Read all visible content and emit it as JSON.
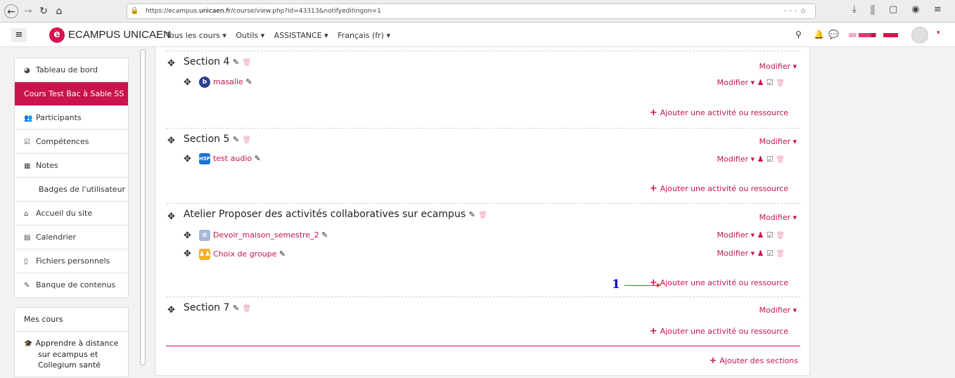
{
  "browser": {
    "url_prefix": "https://ecampus.",
    "url_host": "unicaen.fr",
    "url_suffix": "/course/view.php?id=43313&notifyeditingon=1"
  },
  "navbar": {
    "brand": "ECAMPUS UNICAEN",
    "logo_letter": "e",
    "menu": [
      "Tous les cours ▾",
      "Outils ▾",
      "ASSISTANCE ▾",
      "Français (fr) ▾"
    ]
  },
  "sidebar": {
    "items": [
      {
        "label": "Tableau de bord",
        "icon": "dashboard-icon",
        "glyph": "◕"
      },
      {
        "label": "Cours Test Bac à Sable SS",
        "icon": "",
        "glyph": ""
      },
      {
        "label": "Participants",
        "icon": "users-icon",
        "glyph": "👥"
      },
      {
        "label": "Compétences",
        "icon": "checkbox-icon",
        "glyph": "☑"
      },
      {
        "label": "Notes",
        "icon": "table-icon",
        "glyph": "▦"
      },
      {
        "label": "Badges de l'utilisateur",
        "icon": "",
        "glyph": ""
      },
      {
        "label": "Accueil du site",
        "icon": "home-icon",
        "glyph": "⌂"
      },
      {
        "label": "Calendrier",
        "icon": "calendar-icon",
        "glyph": "▤"
      },
      {
        "label": "Fichiers personnels",
        "icon": "file-icon",
        "glyph": "▯"
      },
      {
        "label": "Banque de contenus",
        "icon": "brush-icon",
        "glyph": "✎"
      }
    ],
    "mes_cours": "Mes cours",
    "course_line1": "Apprendre à distance",
    "course_line2": "sur ecampus et",
    "course_line3": "Collegium santé"
  },
  "main": {
    "modifier": "Modifier ▾",
    "ajouter": "Ajouter une activité ou ressource",
    "ajouter_sections": "Ajouter des sections",
    "sections": [
      {
        "title": "Section 4",
        "activities": [
          {
            "name": "masalle",
            "icon": "bigbluebutton-icon"
          }
        ]
      },
      {
        "title": "Section 5",
        "activities": [
          {
            "name": "test audio",
            "icon": "h5p-icon"
          }
        ]
      },
      {
        "title": "Atelier Proposer des activités collaboratives sur ecampus",
        "activities": [
          {
            "name": "Devoir_maison_semestre_2",
            "icon": "assignment-icon"
          },
          {
            "name": "Choix de groupe",
            "icon": "group-choice-icon"
          }
        ]
      },
      {
        "title": "Section 7",
        "activities": []
      }
    ],
    "annotation": "1"
  }
}
